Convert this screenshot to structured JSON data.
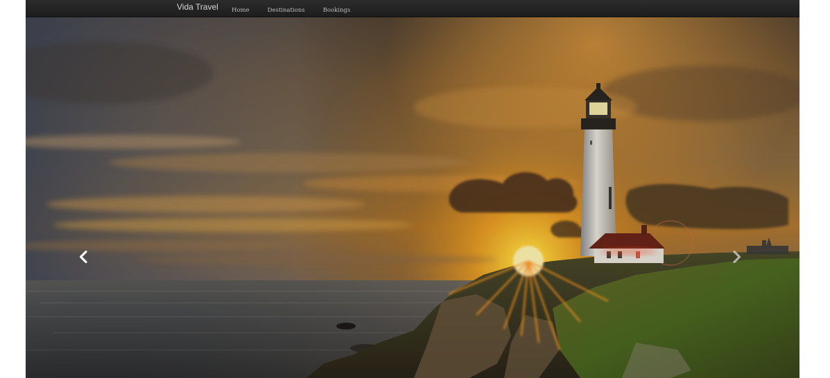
{
  "navbar": {
    "brand": "Vida Travel",
    "items": [
      {
        "label": "Home"
      },
      {
        "label": "Destinations"
      },
      {
        "label": "Bookings"
      }
    ]
  },
  "carousel": {
    "controls": {
      "prev_icon": "chevron-left-icon",
      "next_icon": "chevron-right-icon"
    },
    "slide_image": "lighthouse-sunset-photo"
  },
  "colors": {
    "navbar_bg": "#222222",
    "nav_text": "#bdbdbd",
    "brand_text": "#d7d7d7"
  }
}
